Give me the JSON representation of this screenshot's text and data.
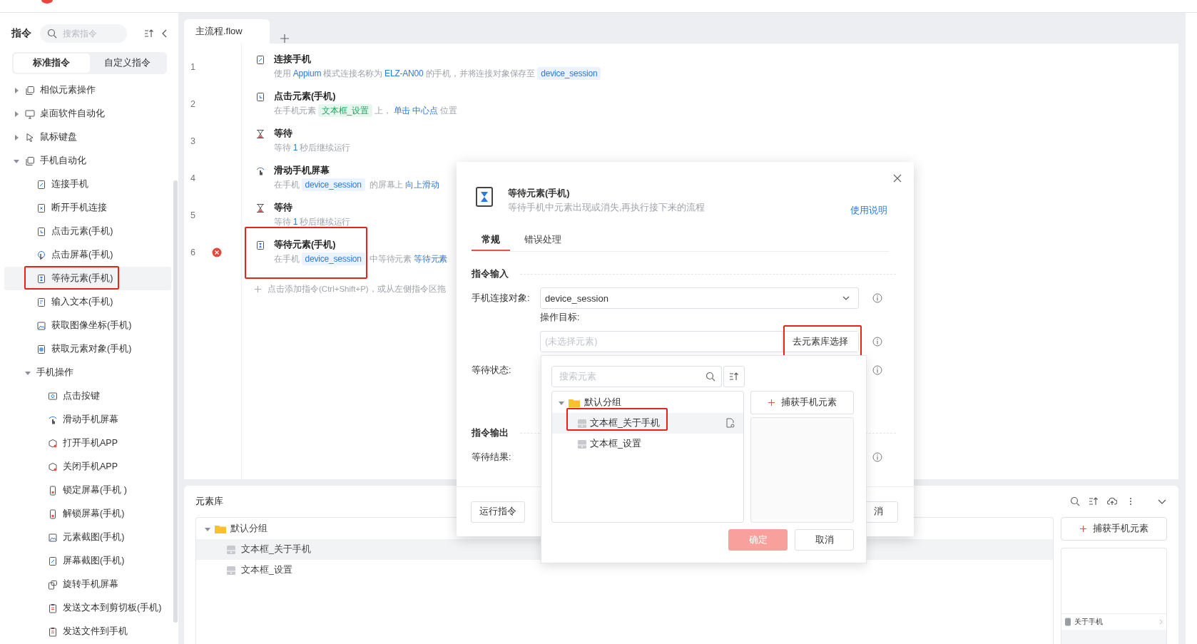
{
  "sidebar": {
    "title": "指令",
    "search": {
      "placeholder": "搜索指令"
    },
    "segments": [
      {
        "label": "标准指令",
        "selected": true
      },
      {
        "label": "自定义指令",
        "selected": false
      }
    ],
    "tree": [
      {
        "label": "相似元素操作",
        "expanded": false,
        "selected": false,
        "highlighted": false
      },
      {
        "label": "桌面软件自动化",
        "expanded": false,
        "selected": false,
        "highlighted": false
      },
      {
        "label": "鼠标键盘",
        "expanded": false,
        "selected": false,
        "highlighted": false
      },
      {
        "label": "手机自动化",
        "expanded": true,
        "selected": false,
        "highlighted": false,
        "children": [
          {
            "label": "连接手机",
            "selected": false,
            "highlighted": false
          },
          {
            "label": "断开手机连接",
            "selected": false,
            "highlighted": false
          },
          {
            "label": "点击元素(手机)",
            "selected": false,
            "highlighted": false
          },
          {
            "label": "点击屏幕(手机)",
            "selected": false,
            "highlighted": false
          },
          {
            "label": "等待元素(手机)",
            "selected": true,
            "highlighted": true
          },
          {
            "label": "输入文本(手机)",
            "selected": false,
            "highlighted": false
          },
          {
            "label": "获取图像坐标(手机)",
            "selected": false,
            "highlighted": false
          },
          {
            "label": "获取元素对象(手机)",
            "selected": false,
            "highlighted": false
          },
          {
            "label": "手机操作",
            "expanded": true,
            "selected": false,
            "highlighted": false,
            "children": [
              {
                "label": "点击按键",
                "selected": false,
                "highlighted": false
              },
              {
                "label": "滑动手机屏幕",
                "selected": false,
                "highlighted": false
              },
              {
                "label": "打开手机APP",
                "selected": false,
                "highlighted": false
              },
              {
                "label": "关闭手机APP",
                "selected": false,
                "highlighted": false
              },
              {
                "label": "锁定屏幕(手机 )",
                "selected": false,
                "highlighted": false
              },
              {
                "label": "解锁屏幕(手机)",
                "selected": false,
                "highlighted": false
              },
              {
                "label": "元素截图(手机)",
                "selected": false,
                "highlighted": false
              },
              {
                "label": "屏幕截图(手机)",
                "selected": false,
                "highlighted": false
              },
              {
                "label": "旋转手机屏幕",
                "selected": false,
                "highlighted": false
              },
              {
                "label": "发送文本到剪切板(手机)",
                "selected": false,
                "highlighted": false
              },
              {
                "label": "发送文件到手机",
                "selected": false,
                "highlighted": false
              }
            ]
          }
        ]
      }
    ]
  },
  "editor": {
    "tabs": [
      {
        "label": "主流程.flow",
        "selected": true
      }
    ],
    "steps": [
      {
        "line": "1",
        "title": "连接手机",
        "error": false,
        "highlighted": false,
        "parts": [
          {
            "text": "使用",
            "kind": "plain"
          },
          {
            "text": "Appium",
            "kind": "value"
          },
          {
            "text": "模式连接名称为",
            "kind": "plain"
          },
          {
            "text": "ELZ-AN00",
            "kind": "value"
          },
          {
            "text": "的手机，并将连接对象保存至",
            "kind": "plain"
          },
          {
            "text": "device_session",
            "kind": "variable"
          }
        ]
      },
      {
        "line": "2",
        "title": "点击元素(手机)",
        "error": false,
        "highlighted": false,
        "parts": [
          {
            "text": "在手机元素",
            "kind": "plain"
          },
          {
            "text": "文本框_设置",
            "kind": "element"
          },
          {
            "text": "上，",
            "kind": "plain"
          },
          {
            "text": "单击",
            "kind": "value"
          },
          {
            "text": "中心点",
            "kind": "value"
          },
          {
            "text": "位置",
            "kind": "plain"
          }
        ]
      },
      {
        "line": "3",
        "title": "等待",
        "error": false,
        "highlighted": false,
        "parts": [
          {
            "text": "等待",
            "kind": "plain"
          },
          {
            "text": "1",
            "kind": "value"
          },
          {
            "text": "秒后继续运行",
            "kind": "plain"
          }
        ]
      },
      {
        "line": "4",
        "title": "滑动手机屏幕",
        "error": false,
        "highlighted": false,
        "parts": [
          {
            "text": "在手机",
            "kind": "plain"
          },
          {
            "text": "device_session",
            "kind": "variable"
          },
          {
            "text": "的屏幕上",
            "kind": "plain"
          },
          {
            "text": "向上滑动",
            "kind": "value"
          }
        ]
      },
      {
        "line": "5",
        "title": "等待",
        "error": false,
        "highlighted": false,
        "parts": [
          {
            "text": "等待",
            "kind": "plain"
          },
          {
            "text": "1",
            "kind": "value"
          },
          {
            "text": "秒后继续运行",
            "kind": "plain"
          }
        ]
      },
      {
        "line": "6",
        "title": "等待元素(手机)",
        "error": true,
        "highlighted": true,
        "parts": [
          {
            "text": "在手机",
            "kind": "plain"
          },
          {
            "text": "device_session",
            "kind": "variable"
          },
          {
            "text": "中等待元素",
            "kind": "plain"
          },
          {
            "text": "等待元素",
            "kind": "value"
          }
        ]
      }
    ],
    "add_hint": "点击添加指令(Ctrl+Shift+P)，或从左侧指令区拖"
  },
  "element_library": {
    "title": "元素库",
    "tree": {
      "label": "默认分组",
      "expanded": true,
      "children": [
        {
          "label": "文本框_关于手机",
          "selected": true
        },
        {
          "label": "文本框_设置",
          "selected": false
        }
      ]
    },
    "capture_button": "捕获手机元素",
    "preview": {
      "row_text": "关于手机"
    }
  },
  "dialog": {
    "title": "等待元素(手机)",
    "subtitle": "等待手机中元素出现或消失,再执行接下来的流程",
    "help_link": "使用说明",
    "tabs": [
      {
        "label": "常规",
        "selected": true
      },
      {
        "label": "错误处理",
        "selected": false
      }
    ],
    "sections": [
      {
        "title": "指令输入",
        "fields": [
          {
            "kind": "select",
            "label": "手机连接对象:",
            "value": "device_session"
          },
          {
            "kind": "picker",
            "label": "操作目标:",
            "placeholder": "(未选择元素)",
            "button": "去元素库选择",
            "highlighted": true
          },
          {
            "kind": "empty",
            "label": "等待状态:"
          }
        ]
      },
      {
        "title": "指令输出",
        "fields": [
          {
            "kind": "empty",
            "label": "等待结果:"
          }
        ]
      }
    ],
    "run_button": "运行指令",
    "cancel_button": "消"
  },
  "popup": {
    "search": {
      "placeholder": "搜索元素"
    },
    "tree": {
      "label": "默认分组",
      "expanded": true,
      "children": [
        {
          "label": "文本框_关于手机",
          "selected": true,
          "highlighted": true
        },
        {
          "label": "文本框_设置",
          "selected": false,
          "highlighted": false
        }
      ]
    },
    "capture_button": "捕获手机元素",
    "confirm": {
      "label": "确定",
      "disabled": true
    },
    "cancel": "取消"
  }
}
